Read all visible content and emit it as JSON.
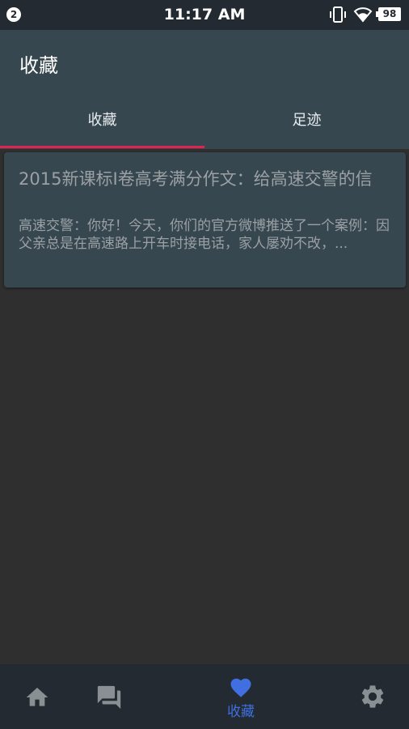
{
  "status_bar": {
    "notification_count": "2",
    "time": "11:17 AM",
    "battery": "98",
    "icons": [
      "vibrate-icon",
      "wifi-icon",
      "battery-icon"
    ]
  },
  "app_bar": {
    "title": "收藏",
    "tabs": [
      {
        "label": "收藏",
        "selected": true
      },
      {
        "label": "足迹",
        "selected": false
      }
    ]
  },
  "favorites": [
    {
      "title": "2015新课标I卷高考满分作文：给高速交警的信",
      "excerpt": "高速交警：你好！今天，你们的官方微博推送了一个案例：因父亲总是在高速路上开车时接电话，家人屡劝不改，..."
    }
  ],
  "bottom_nav": {
    "items": [
      {
        "icon": "home-icon",
        "label": ""
      },
      {
        "icon": "chat-icon",
        "label": ""
      },
      {
        "icon": "heart-icon",
        "label": "收藏",
        "active": true
      },
      {
        "icon": "gear-icon",
        "label": ""
      }
    ]
  },
  "colors": {
    "status_bar": "#232a31",
    "app_bar": "#37474f",
    "tab_indicator": "#e3234f",
    "background": "#2f2f2f",
    "card": "#37474f",
    "active_nav": "#3f6fe0",
    "inactive_nav": "#8a8f93"
  }
}
